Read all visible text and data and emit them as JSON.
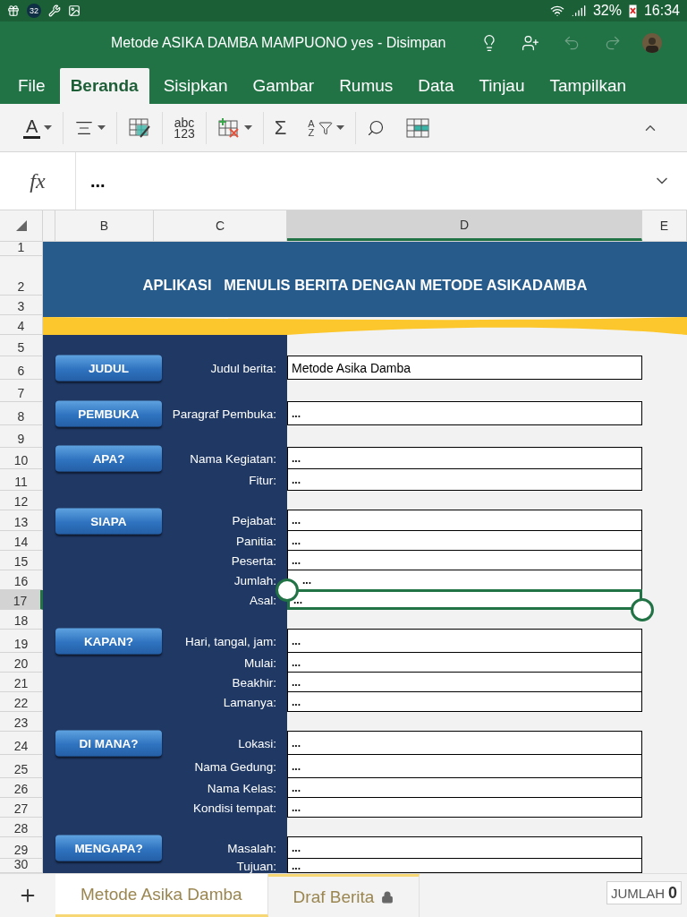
{
  "status_bar": {
    "badge": "32",
    "battery": "32%",
    "time": "16:34"
  },
  "title_bar": {
    "title": "Metode ASIKA DAMBA MAMPUONO yes - Disimpan",
    "undo_disabled": true,
    "redo_disabled": true
  },
  "ribbon_tabs": [
    {
      "label": "File",
      "selected": false
    },
    {
      "label": "Beranda",
      "selected": true
    },
    {
      "label": "Sisipkan",
      "selected": false
    },
    {
      "label": "Gambar",
      "selected": false
    },
    {
      "label": "Rumus",
      "selected": false
    },
    {
      "label": "Data",
      "selected": false
    },
    {
      "label": "Tinjau",
      "selected": false
    },
    {
      "label": "Tampilkan",
      "selected": false
    }
  ],
  "toolbar": [
    {
      "kind": "font-color",
      "text": "A"
    },
    {
      "kind": "align"
    },
    {
      "kind": "fill"
    },
    {
      "kind": "number-format",
      "text": "abc",
      "subtext": "123"
    },
    {
      "kind": "cells"
    },
    {
      "kind": "sum",
      "text": "Σ"
    },
    {
      "kind": "sort-filter",
      "text": "A",
      "subtext": "Z"
    },
    {
      "kind": "find"
    },
    {
      "kind": "table"
    }
  ],
  "formula_bar": {
    "function_label": "fx",
    "value": "..."
  },
  "columns": [
    {
      "label": "B",
      "selected": false
    },
    {
      "label": "C",
      "selected": false
    },
    {
      "label": "D",
      "selected": true
    },
    {
      "label": "E",
      "selected": false
    }
  ],
  "banner": {
    "title": "APLIKASI   MENULIS BERITA DENGAN METODE ASIKADAMBA"
  },
  "rows": [
    {
      "number": "1",
      "selected": false
    },
    {
      "number": "2",
      "selected": false
    },
    {
      "number": "3",
      "selected": false
    },
    {
      "number": "4",
      "selected": false
    },
    {
      "number": "5",
      "selected": false
    },
    {
      "number": "6",
      "selected": false,
      "button": "JUDUL",
      "label": "Judul berita:",
      "value": "Metode Asika Damba"
    },
    {
      "number": "7",
      "selected": false
    },
    {
      "number": "8",
      "selected": false,
      "button": "PEMBUKA",
      "label": "Paragraf Pembuka:",
      "value": "..."
    },
    {
      "number": "9",
      "selected": false
    },
    {
      "number": "10",
      "selected": false,
      "button": "APA?",
      "label": "Nama Kegiatan:",
      "value": "..."
    },
    {
      "number": "11",
      "selected": false,
      "label": "Fitur:",
      "value": "..."
    },
    {
      "number": "12",
      "selected": false
    },
    {
      "number": "13",
      "selected": false,
      "button": "SIAPA",
      "label": "Pejabat:",
      "value": "..."
    },
    {
      "number": "14",
      "selected": false,
      "label": "Panitia:",
      "value": "..."
    },
    {
      "number": "15",
      "selected": false,
      "label": "Peserta:",
      "value": "..."
    },
    {
      "number": "16",
      "selected": false,
      "label": "Jumlah:",
      "value": "..."
    },
    {
      "number": "17",
      "selected": true,
      "label": "Asal:",
      "value": "..."
    },
    {
      "number": "18",
      "selected": false
    },
    {
      "number": "19",
      "selected": false,
      "button": "KAPAN?",
      "label": "Hari, tangal, jam:",
      "value": "..."
    },
    {
      "number": "20",
      "selected": false,
      "label": "Mulai:",
      "value": "..."
    },
    {
      "number": "21",
      "selected": false,
      "label": "Beakhir:",
      "value": "..."
    },
    {
      "number": "22",
      "selected": false,
      "label": "Lamanya:",
      "value": "..."
    },
    {
      "number": "23",
      "selected": false
    },
    {
      "number": "24",
      "selected": false,
      "button": "DI MANA?",
      "label": "Lokasi:",
      "value": "..."
    },
    {
      "number": "25",
      "selected": false,
      "label": "Nama Gedung:",
      "value": "..."
    },
    {
      "number": "26",
      "selected": false,
      "label": "Nama Kelas:",
      "value": "..."
    },
    {
      "number": "27",
      "selected": false,
      "label": "Kondisi tempat:",
      "value": "..."
    },
    {
      "number": "28",
      "selected": false
    },
    {
      "number": "29",
      "selected": false,
      "button": "MENGAPA?",
      "label": "Masalah:",
      "value": "..."
    },
    {
      "number": "30",
      "selected": false,
      "label": "Tujuan:",
      "value": "..."
    }
  ],
  "sheet_tabs": [
    {
      "label": "Metode Asika Damba",
      "selected": true,
      "locked": false
    },
    {
      "label": "Draf Berita",
      "selected": false,
      "locked": true
    }
  ],
  "summary": {
    "label": "JUMLAH",
    "value": "0"
  }
}
